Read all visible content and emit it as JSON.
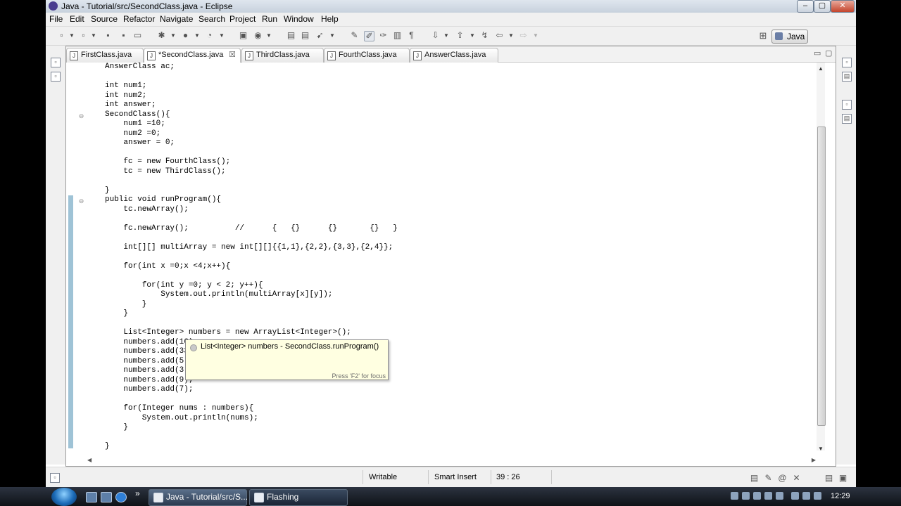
{
  "window": {
    "title": "Java - Tutorial/src/SecondClass.java - Eclipse",
    "controls": {
      "minimize": "–",
      "maximize": "▢",
      "close": "✕"
    }
  },
  "menu": [
    "File",
    "Edit",
    "Source",
    "Refactor",
    "Navigate",
    "Search",
    "Project",
    "Run",
    "Window",
    "Help"
  ],
  "perspective": {
    "label": "Java"
  },
  "tabs": [
    {
      "label": "FirstClass.java",
      "active": false
    },
    {
      "label": "*SecondClass.java",
      "active": true,
      "close": "☒"
    },
    {
      "label": "ThirdClass.java",
      "active": false
    },
    {
      "label": "FourthClass.java",
      "active": false
    },
    {
      "label": "AnswerClass.java",
      "active": false
    }
  ],
  "editor": {
    "code_lines": [
      "AnswerClass ac;",
      "",
      "int num1;",
      "int num2;",
      "int answer;",
      "SecondClass(){",
      "    num1 =10;",
      "    num2 =0;",
      "    answer = 0;",
      "",
      "    fc = new FourthClass();",
      "    tc = new ThirdClass();",
      "",
      "}",
      "public void runProgram(){",
      "    tc.newArray();",
      "",
      "    fc.newArray();          //      {   {}      {}       {}   }",
      "",
      "    int[][] multiArray = new int[][]{{1,1},{2,2},{3,3},{2,4}};",
      "",
      "    for(int x =0;x <4;x++){",
      "",
      "        for(int y =0; y < 2; y++){",
      "            System.out.println(multiArray[x][y]);",
      "        }",
      "    }",
      "",
      "    List<Integer> numbers = new ArrayList<Integer>();",
      "    numbers.add(16);",
      "    numbers.add(33);",
      "    numbers.add(5);",
      "    numbers.add(3);",
      "    numbers.add(9);",
      "    numbers.add(7);",
      "",
      "    for(Integer nums : numbers){",
      "        System.out.println(nums);",
      "    }",
      "",
      "}"
    ]
  },
  "tooltip": {
    "text": "List<Integer> numbers - SecondClass.runProgram()",
    "hint": "Press 'F2' for focus"
  },
  "status": {
    "writable": "Writable",
    "insert_mode": "Smart Insert",
    "position": "39 : 26"
  },
  "taskbar": {
    "buttons": [
      {
        "label": "Java - Tutorial/src/S..."
      },
      {
        "label": "Flashing"
      }
    ],
    "expand": "»",
    "clock": "12:29"
  },
  "colors": {
    "quick_diff": "#9fc3d6",
    "tooltip_bg": "#ffffe1"
  }
}
